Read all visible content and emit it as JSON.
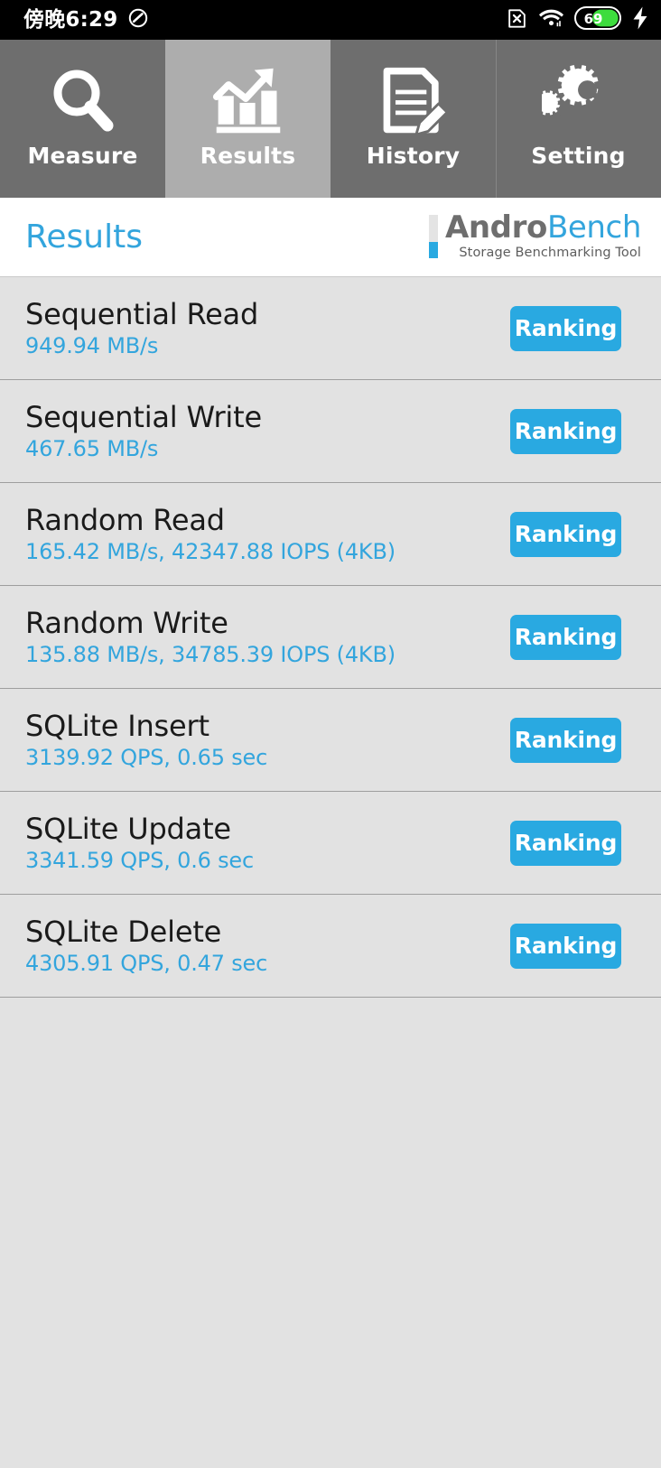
{
  "statusbar": {
    "time": "傍晚6:29",
    "dnd_icon": "do-not-disturb-icon",
    "sim_icon": "no-sim-icon",
    "wifi_icon": "wifi-icon",
    "battery_level": "69",
    "charging_icon": "charging-bolt-icon"
  },
  "tabs": [
    {
      "label": "Measure",
      "icon": "search-icon",
      "active": false
    },
    {
      "label": "Results",
      "icon": "bar-chart-icon",
      "active": true
    },
    {
      "label": "History",
      "icon": "document-pencil-icon",
      "active": false
    },
    {
      "label": "Setting",
      "icon": "gears-icon",
      "active": false
    }
  ],
  "header": {
    "title": "Results",
    "logo_andro": "Andro",
    "logo_bench": "Bench",
    "logo_subtitle": "Storage Benchmarking Tool"
  },
  "results": [
    {
      "name": "Sequential Read",
      "value": "949.94 MB/s",
      "button": "Ranking"
    },
    {
      "name": "Sequential Write",
      "value": "467.65 MB/s",
      "button": "Ranking"
    },
    {
      "name": "Random Read",
      "value": "165.42 MB/s, 42347.88 IOPS (4KB)",
      "button": "Ranking"
    },
    {
      "name": "Random Write",
      "value": "135.88 MB/s, 34785.39 IOPS (4KB)",
      "button": "Ranking"
    },
    {
      "name": "SQLite Insert",
      "value": "3139.92 QPS, 0.65 sec",
      "button": "Ranking"
    },
    {
      "name": "SQLite Update",
      "value": "3341.59 QPS, 0.6 sec",
      "button": "Ranking"
    },
    {
      "name": "SQLite Delete",
      "value": "4305.91 QPS, 0.47 sec",
      "button": "Ranking"
    }
  ],
  "colors": {
    "accent_blue": "#29a9e1",
    "text_blue": "#33a5dd",
    "tab_inactive": "#6e6e6e",
    "tab_active": "#adadad",
    "list_bg": "#e2e2e2",
    "battery_green": "#3ddc3d"
  }
}
